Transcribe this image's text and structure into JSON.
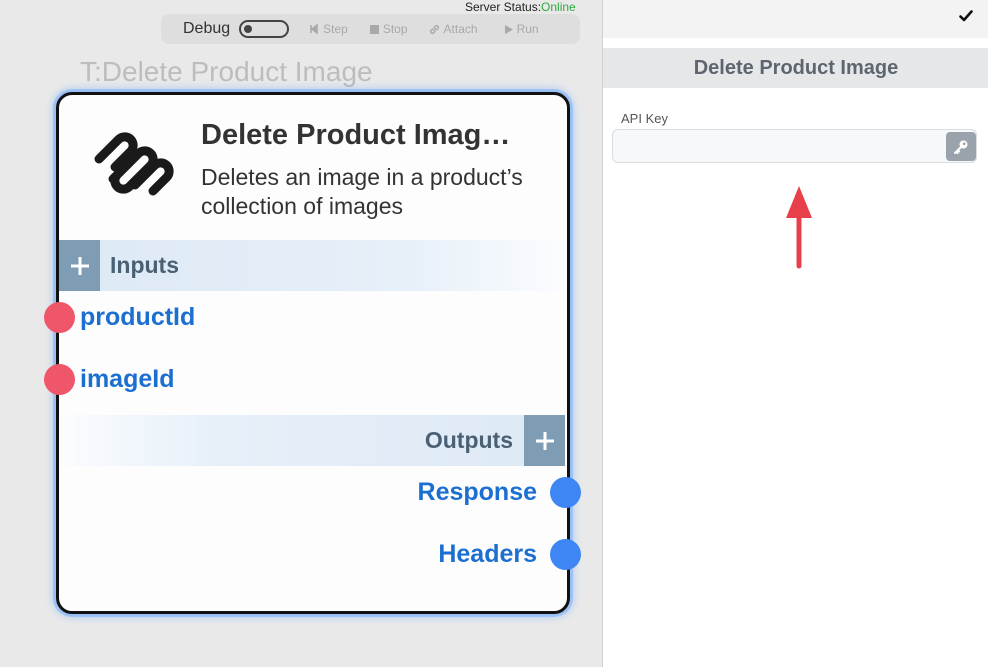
{
  "server_status": {
    "label": "Server Status:",
    "value": "Online"
  },
  "toolbar": {
    "debug_label": "Debug",
    "debug_enabled": false,
    "buttons": {
      "step": "Step",
      "stop": "Stop",
      "attach": "Attach",
      "run": "Run"
    }
  },
  "canvas": {
    "node_title_ghost": "T:Delete Product Image"
  },
  "node": {
    "name": "Delete Product Imag…",
    "description": "Deletes an image in a product’s collection of images",
    "inputs_label": "Inputs",
    "outputs_label": "Outputs",
    "inputs": [
      "productId",
      "imageId"
    ],
    "outputs": [
      "Response",
      "Headers"
    ],
    "logo": "squarespace-logo-icon"
  },
  "panel": {
    "title": "Delete Product Image",
    "fields": {
      "api_key": {
        "label": "API Key",
        "value": "",
        "placeholder": ""
      }
    }
  },
  "colors": {
    "input_port": "#f0566a",
    "output_port": "#3d86f4",
    "port_label": "#1b6fd0",
    "online": "#2eaa3c",
    "annotation": "#e8404a"
  }
}
